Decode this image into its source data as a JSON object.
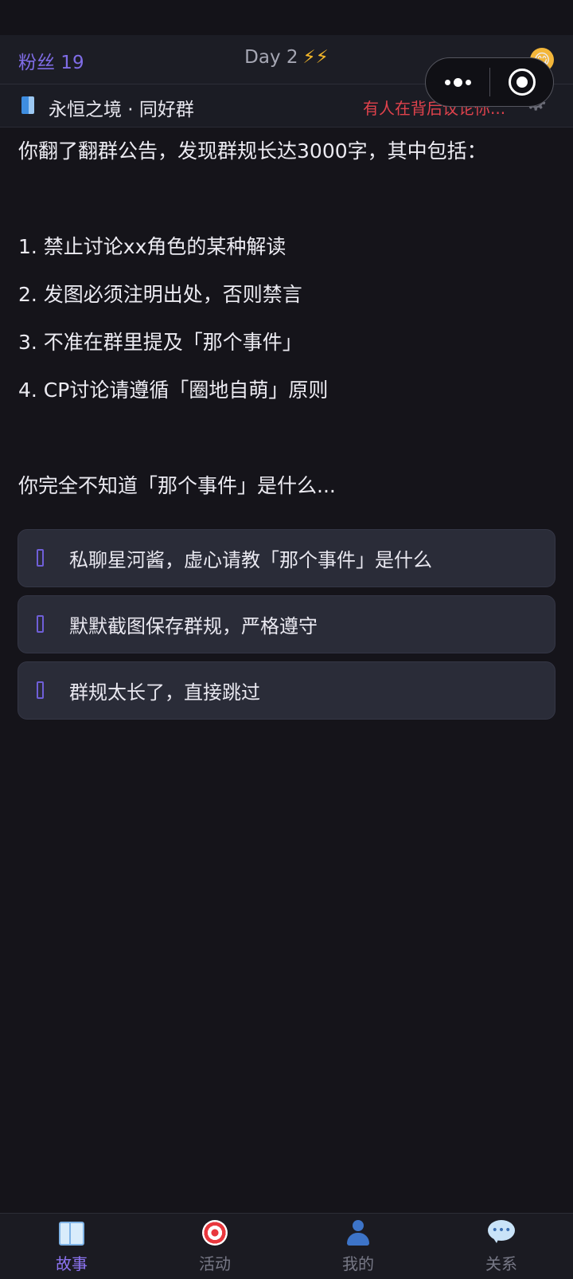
{
  "header": {
    "fans_label": "粉丝 19",
    "day_label": "Day 2",
    "energy": "⚡⚡",
    "mood_emoji": "😋"
  },
  "group": {
    "name": "永恒之境 · 同好群",
    "alert": "有人在背后议论你..."
  },
  "story": {
    "intro": "你翻了翻群公告，发现群规长达3000字，其中包括：",
    "rules": [
      "1. 禁止讨论xx角色的某种解读",
      "2. 发图必须注明出处，否则禁言",
      "3. 不准在群里提及「那个事件」",
      "4. CP讨论请遵循「圈地自萌」原则"
    ],
    "outro": "你完全不知道「那个事件」是什么..."
  },
  "choices": [
    {
      "label": "私聊星河酱，虚心请教「那个事件」是什么"
    },
    {
      "label": "默默截图保存群规，严格遵守"
    },
    {
      "label": "群规太长了，直接跳过"
    }
  ],
  "tabs": [
    {
      "label": "故事",
      "icon": "book-icon",
      "active": true
    },
    {
      "label": "活动",
      "icon": "target-icon",
      "active": false
    },
    {
      "label": "我的",
      "icon": "person-icon",
      "active": false
    },
    {
      "label": "关系",
      "icon": "chat-bubble-icon",
      "active": false
    }
  ],
  "colors": {
    "background": "#15141a",
    "accent": "#7f6ce6",
    "alert": "#e0424c",
    "energy": "#f5b82a"
  }
}
